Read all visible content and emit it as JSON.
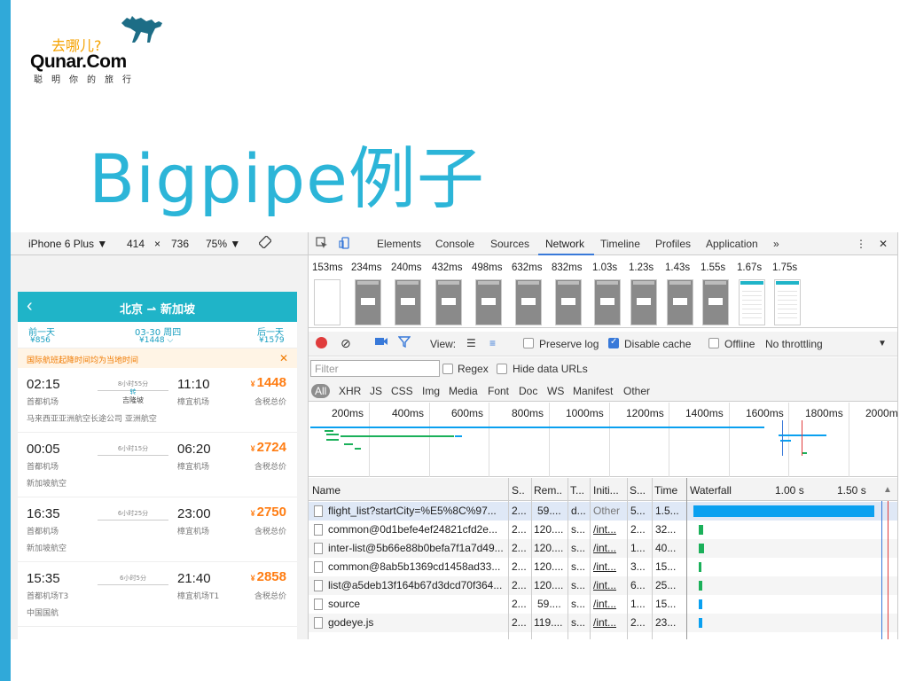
{
  "slide": {
    "logo_cn": "去哪儿?",
    "logo_brand": "Qunar.Com",
    "logo_sub": "聪明你的旅行",
    "title": "Bigpipe例子",
    "accent": "#30a9d9"
  },
  "device_toolbar": {
    "device": "iPhone 6 Plus ▼",
    "width": "414",
    "times": "×",
    "height": "736",
    "zoom": "75% ▼",
    "rotate_icon": "rotate-icon"
  },
  "phone": {
    "header_title": "北京 ⇀ 新加坡",
    "prev_day": "前一天",
    "prev_price": "¥856",
    "current_date": "03-30 周四",
    "current_price": "¥1448 ⌵",
    "next_day": "后一天",
    "next_price": "¥1579",
    "notice": "国际航班起降时间均为当地时间",
    "flights": [
      {
        "dep": "02:15",
        "dep_airport": "首都机场",
        "duration": "8小时55分",
        "stop_label": "转",
        "stop": "吉隆坡",
        "arr": "11:10",
        "arr_airport": "樟宜机场",
        "price": "1448",
        "tax": "含税总价",
        "airline": "马来西亚亚洲航空长途公司 亚洲航空"
      },
      {
        "dep": "00:05",
        "dep_airport": "首都机场",
        "duration": "6小时15分",
        "stop_label": "",
        "stop": "",
        "arr": "06:20",
        "arr_airport": "樟宜机场",
        "price": "2724",
        "tax": "含税总价",
        "airline": "新加坡航空"
      },
      {
        "dep": "16:35",
        "dep_airport": "首都机场",
        "duration": "6小时25分",
        "stop_label": "",
        "stop": "",
        "arr": "23:00",
        "arr_airport": "樟宜机场",
        "price": "2750",
        "tax": "含税总价",
        "airline": "新加坡航空"
      },
      {
        "dep": "15:35",
        "dep_airport": "首都机场T3",
        "duration": "6小时5分",
        "stop_label": "",
        "stop": "",
        "arr": "21:40",
        "arr_airport": "樟宜机场T1",
        "price": "2858",
        "tax": "含税总价",
        "airline": "中国国航"
      }
    ]
  },
  "devtools": {
    "tabs": [
      "Elements",
      "Console",
      "Sources",
      "Network",
      "Timeline",
      "Profiles",
      "Application"
    ],
    "active_tab": "Network",
    "more": "»",
    "menu": "⋮",
    "close": "✕",
    "filmstrip_times": [
      "153ms",
      "234ms",
      "240ms",
      "432ms",
      "498ms",
      "632ms",
      "832ms",
      "1.03s",
      "1.23s",
      "1.43s",
      "1.55s",
      "1.67s",
      "1.75s"
    ],
    "toolbar": {
      "view_label": "View:",
      "preserve_log": "Preserve log",
      "preserve_log_checked": false,
      "disable_cache": "Disable cache",
      "disable_cache_checked": true,
      "offline": "Offline",
      "offline_checked": false,
      "throttling": "No throttling",
      "throttling_arrow": "▼"
    },
    "filter": {
      "placeholder": "Filter",
      "regex": "Regex",
      "hide_data_urls": "Hide data URLs"
    },
    "types": [
      "All",
      "XHR",
      "JS",
      "CSS",
      "Img",
      "Media",
      "Font",
      "Doc",
      "WS",
      "Manifest",
      "Other"
    ],
    "overview_ticks": [
      "200ms",
      "400ms",
      "600ms",
      "800ms",
      "1000ms",
      "1200ms",
      "1400ms",
      "1600ms",
      "1800ms",
      "2000m"
    ],
    "columns": [
      "Name",
      "S..",
      "Rem..",
      "T...",
      "Initi...",
      "S...",
      "Time",
      "Waterfall"
    ],
    "waterfall_ticks": [
      "1.00 s",
      "1.50 s"
    ],
    "sort_arrow": "▲",
    "rows": [
      {
        "name": "flight_list?startCity=%E5%8C%97...",
        "status": "2...",
        "remote": "59....",
        "type": "d...",
        "initiator": "Other",
        "size": "5...",
        "time": "1.5..."
      },
      {
        "name": "common@0d1befe4ef24821cfd2e...",
        "status": "2...",
        "remote": "120....",
        "type": "s...",
        "initiator": "/int...",
        "size": "2...",
        "time": "32..."
      },
      {
        "name": "inter-list@5b66e88b0befa7f1a7d49...",
        "status": "2...",
        "remote": "120....",
        "type": "s...",
        "initiator": "/int...",
        "size": "1...",
        "time": "40..."
      },
      {
        "name": "common@8ab5b1369cd1458ad33...",
        "status": "2...",
        "remote": "120....",
        "type": "s...",
        "initiator": "/int...",
        "size": "3...",
        "time": "15..."
      },
      {
        "name": "list@a5deb13f164b67d3dcd70f364...",
        "status": "2...",
        "remote": "120....",
        "type": "s...",
        "initiator": "/int...",
        "size": "6...",
        "time": "25..."
      },
      {
        "name": "source",
        "status": "2...",
        "remote": "59....",
        "type": "s...",
        "initiator": "/int...",
        "size": "1...",
        "time": "15..."
      },
      {
        "name": "godeye.js",
        "status": "2...",
        "remote": "119....",
        "type": "s...",
        "initiator": "/int...",
        "size": "2...",
        "time": "23..."
      }
    ],
    "colors": {
      "blue": "#0aa0f0",
      "green": "#1bb05a",
      "red": "#e03c3c",
      "accent": "#3879d9"
    }
  }
}
